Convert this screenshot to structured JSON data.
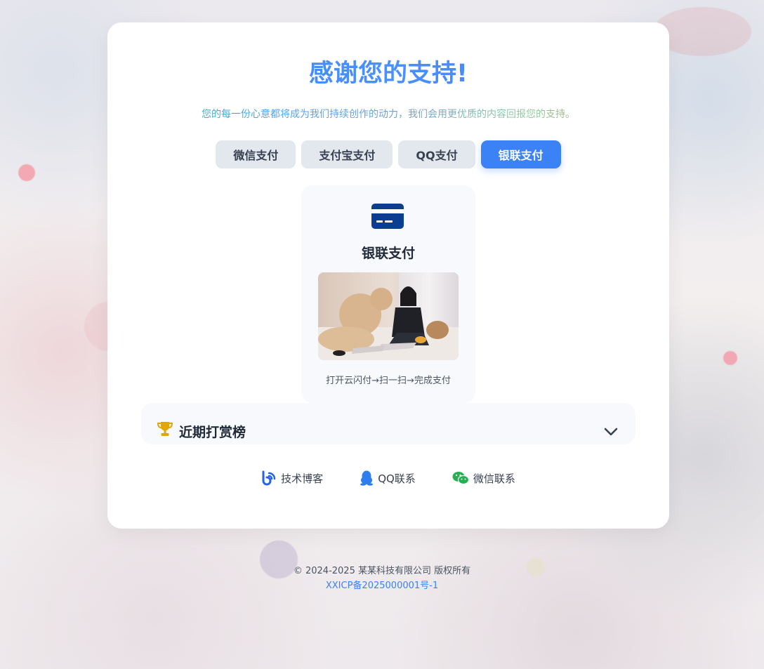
{
  "header": {
    "title": "感谢您的支持!",
    "subtitle": "您的每一份心意都将成为我们持续创作的动力，我们会用更优质的内容回报您的支持。"
  },
  "tabs": [
    {
      "label": "微信支付",
      "active": false
    },
    {
      "label": "支付宝支付",
      "active": false
    },
    {
      "label": "QQ支付",
      "active": false
    },
    {
      "label": "银联支付",
      "active": true
    }
  ],
  "payment_panel": {
    "icon": "unionpay-card-icon",
    "name": "银联支付",
    "hint": "打开云闪付→扫一扫→完成支付"
  },
  "ranking": {
    "icon": "trophy-icon",
    "title": "近期打赏榜",
    "toggle_icon": "chevron-down-icon"
  },
  "links": [
    {
      "icon": "blog-icon",
      "label": "技术博客"
    },
    {
      "icon": "qq-icon",
      "label": "QQ联系"
    },
    {
      "icon": "wechat-icon",
      "label": "微信联系"
    }
  ],
  "footer": {
    "copyright": "© 2024-2025 某某科技有限公司 版权所有",
    "icp": "XXICP备2025000001号-1"
  },
  "colors": {
    "accent": "#3b82f6",
    "tab_bg": "#e3e8ef",
    "panel_bg": "#f7f9fc",
    "trophy": "#e1a600",
    "unionpay": "#0b3d91",
    "wechat": "#22b14c"
  }
}
